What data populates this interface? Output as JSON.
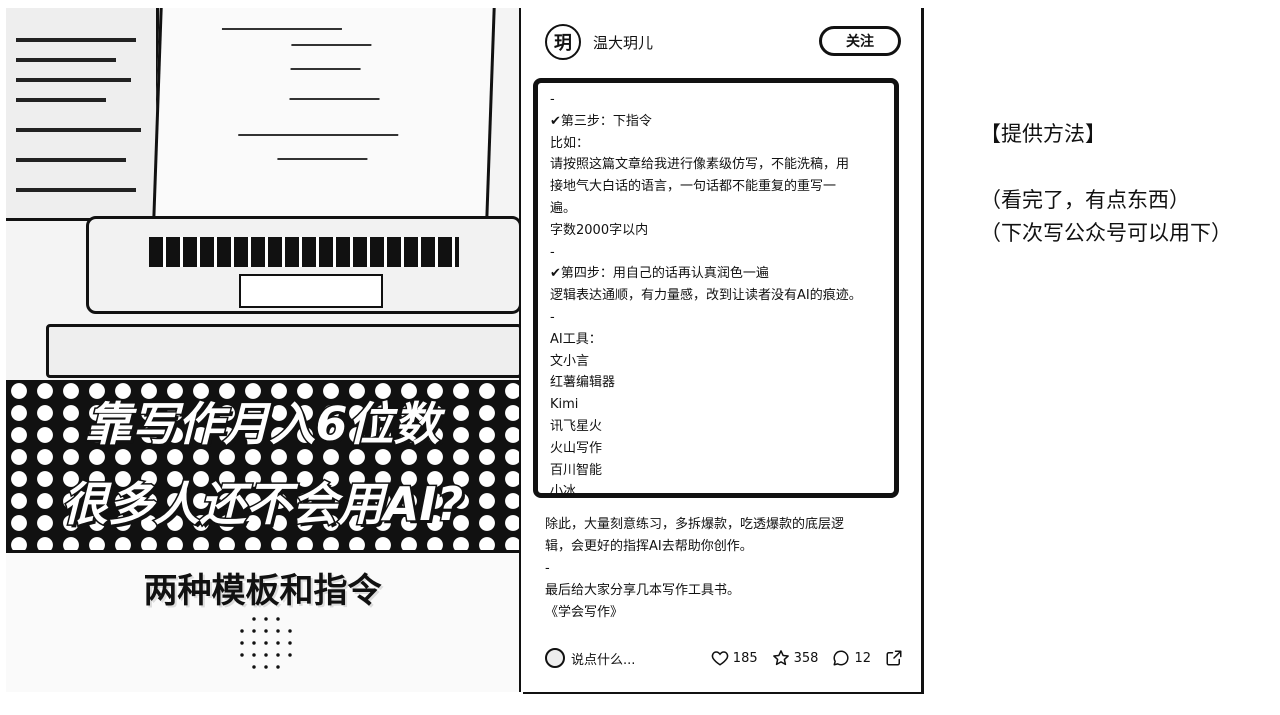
{
  "photo": {
    "title_line1": "靠写作月入6位数",
    "title_line2": "很多人还不会用AI?",
    "caption": "两种模板和指令"
  },
  "post": {
    "author": {
      "name": "温大玥儿",
      "avatar_glyph": "玥"
    },
    "follow_label": "关注",
    "content_lines": [
      "-",
      "✔第三步：下指令",
      "比如：",
      "请按照这篇文章给我进行像素级仿写，不能洗稿，用",
      "接地气大白话的语言，一句话都不能重复的重写一",
      "遍。",
      "字数2000字以内",
      "-",
      "✔第四步：用自己的话再认真润色一遍",
      "逻辑表达通顺，有力量感，改到让读者没有AI的痕迹。",
      "-",
      "AI工具：",
      "文小言",
      "红薯编辑器",
      "Kimi",
      "讯飞星火",
      "火山写作",
      "百川智能",
      "小冰"
    ],
    "after_lines": [
      "除此，大量刻意练习，多拆爆款，吃透爆款的底层逻",
      "辑，会更好的指挥AI去帮助你创作。",
      "-",
      "最后给大家分享几本写作工具书。",
      "《学会写作》"
    ],
    "comment_placeholder": "说点什么...",
    "likes": "185",
    "stars": "358",
    "comments": "12"
  },
  "side_note": {
    "heading": "【提供方法】",
    "line1": "（看完了，有点东西）",
    "line2": "（下次写公众号可以用下）"
  }
}
